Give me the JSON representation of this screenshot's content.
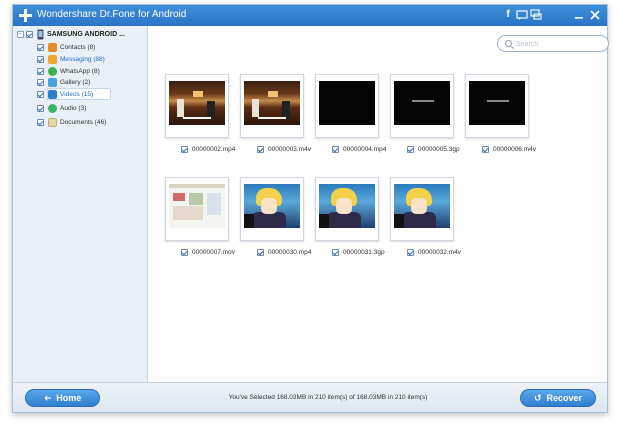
{
  "window": {
    "title": "Wondershare Dr.Fone for Android",
    "accent": "#2a74c6"
  },
  "titlebar": {
    "icons": [
      "facebook-icon",
      "feedback-icon",
      "chat-icon",
      "minimize-icon",
      "close-icon"
    ]
  },
  "sidebar": {
    "device": {
      "label": "SAMSUNG ANDROID ...",
      "expander": "-"
    },
    "items": [
      {
        "label": "Contacts (8)",
        "icon": "contacts-icon",
        "color": "#e88b2d"
      },
      {
        "label": "Messaging (88)",
        "icon": "messaging-icon",
        "color": "#f0a830"
      },
      {
        "label": "WhatsApp (8)",
        "icon": "whatsapp-icon",
        "color": "#38b34a"
      },
      {
        "label": "Gallery (2)",
        "icon": "gallery-icon",
        "color": "#4aa3df"
      },
      {
        "label": "Videos (15)",
        "icon": "videos-icon",
        "color": "#2c7fd0"
      },
      {
        "label": "Audio (3)",
        "icon": "audio-icon",
        "color": "#3bb36b"
      },
      {
        "label": "Documents (46)",
        "icon": "documents-icon",
        "color": "#e6d9a8"
      }
    ],
    "selected": "Videos (15)"
  },
  "search": {
    "placeholder": "Search"
  },
  "files": [
    {
      "name": "00000002.mp4",
      "thumb": "restaurant"
    },
    {
      "name": "00000003.m4v",
      "thumb": "restaurant"
    },
    {
      "name": "00000004.mp4",
      "thumb": "dark"
    },
    {
      "name": "00000005.3gp",
      "thumb": "dark"
    },
    {
      "name": "00000006.m4v",
      "thumb": "dark"
    },
    {
      "name": "00000007.mov",
      "thumb": "screenshot"
    },
    {
      "name": "00000030.mp4",
      "thumb": "anime"
    },
    {
      "name": "00000031.3gp",
      "thumb": "anime"
    },
    {
      "name": "00000032.m4v",
      "thumb": "anime"
    }
  ],
  "bottom": {
    "home_label": "Home",
    "recover_label": "Recover",
    "status": "You've Selected 168.03MB in 210 item(s) of 168.03MB in 210 item(s)"
  }
}
